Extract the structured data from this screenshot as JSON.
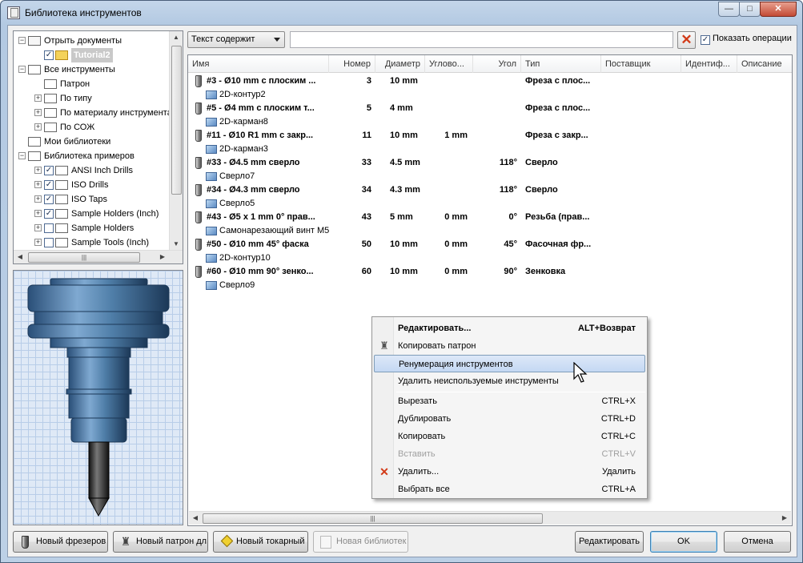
{
  "window": {
    "title": "Библиотека инструментов",
    "controls": {
      "minimize": "—",
      "maximize": "□",
      "close": "✕"
    }
  },
  "tree": {
    "items": [
      {
        "label": "Отрыть документы",
        "level": 0,
        "expander": "−",
        "checked": null,
        "icon": "open-folder-icon"
      },
      {
        "label": "Tutorial2",
        "level": 1,
        "expander": "",
        "checked": true,
        "icon": "yellow-folder-icon",
        "selected": true
      },
      {
        "label": "Все инструменты",
        "level": 0,
        "expander": "−",
        "checked": null,
        "icon": "search-folder-icon"
      },
      {
        "label": "Патрон",
        "level": 1,
        "expander": "",
        "checked": null,
        "icon": "search-folder-icon"
      },
      {
        "label": "По типу",
        "level": 1,
        "expander": "+",
        "checked": null,
        "icon": "search-folder-icon"
      },
      {
        "label": "По материалу инструмента",
        "level": 1,
        "expander": "+",
        "checked": null,
        "icon": "search-folder-icon"
      },
      {
        "label": "По СОЖ",
        "level": 1,
        "expander": "+",
        "checked": null,
        "icon": "search-folder-icon"
      },
      {
        "label": "Мои библиотеки",
        "level": 0,
        "expander": "",
        "checked": null,
        "icon": "folder-icon"
      },
      {
        "label": "Библиотека примеров",
        "level": 0,
        "expander": "−",
        "checked": null,
        "icon": "folder-icon"
      },
      {
        "label": "ANSI Inch Drills",
        "level": 1,
        "expander": "+",
        "checked": true,
        "icon": "library-icon"
      },
      {
        "label": "ISO Drills",
        "level": 1,
        "expander": "+",
        "checked": true,
        "icon": "library-icon"
      },
      {
        "label": "ISO Taps",
        "level": 1,
        "expander": "+",
        "checked": true,
        "icon": "library-icon"
      },
      {
        "label": "Sample Holders (Inch)",
        "level": 1,
        "expander": "+",
        "checked": true,
        "icon": "library-icon"
      },
      {
        "label": "Sample Holders",
        "level": 1,
        "expander": "+",
        "checked": false,
        "icon": "library-icon"
      },
      {
        "label": "Sample Tools (Inch)",
        "level": 1,
        "expander": "+",
        "checked": false,
        "icon": "library-icon"
      }
    ]
  },
  "filter": {
    "dropdown_value": "Текст содержит",
    "search_value": "",
    "show_operations_label": "Показать операции",
    "show_operations_checked": true
  },
  "list": {
    "columns": [
      "Имя",
      "Номер",
      "Диаметр",
      "Углово...",
      "Угол",
      "Тип",
      "Поставщик",
      "Идентиф...",
      "Описание"
    ],
    "rows": [
      {
        "name": "#3 - Ø10 mm с плоским ...",
        "number": "3",
        "diameter": "10 mm",
        "corner": "",
        "angle": "",
        "type": "Фреза с плос...",
        "op": "2D-контур2"
      },
      {
        "name": "#5 - Ø4 mm с плоским т...",
        "number": "5",
        "diameter": "4 mm",
        "corner": "",
        "angle": "",
        "type": "Фреза с плос...",
        "op": "2D-карман8"
      },
      {
        "name": "#11 - Ø10 R1 mm с закр...",
        "number": "11",
        "diameter": "10 mm",
        "corner": "1 mm",
        "angle": "",
        "type": "Фреза с закр...",
        "op": "2D-карман3"
      },
      {
        "name": "#33 - Ø4.5 mm сверло",
        "number": "33",
        "diameter": "4.5 mm",
        "corner": "",
        "angle": "118°",
        "type": "Сверло",
        "op": "Сверло7"
      },
      {
        "name": "#34 - Ø4.3 mm сверло",
        "number": "34",
        "diameter": "4.3 mm",
        "corner": "",
        "angle": "118°",
        "type": "Сверло",
        "op": "Сверло5"
      },
      {
        "name": "#43 - Ø5 x 1 mm 0° прав...",
        "number": "43",
        "diameter": "5 mm",
        "corner": "0 mm",
        "angle": "0°",
        "type": "Резьба (прав...",
        "op": "Самонарезающий винт M5"
      },
      {
        "name": "#50 - Ø10 mm 45° фаска",
        "number": "50",
        "diameter": "10 mm",
        "corner": "0 mm",
        "angle": "45°",
        "type": "Фасочная фр...",
        "op": "2D-контур10"
      },
      {
        "name": "#60 - Ø10 mm 90° зенко...",
        "number": "60",
        "diameter": "10 mm",
        "corner": "0 mm",
        "angle": "90°",
        "type": "Зенковка",
        "op": "Сверло9"
      }
    ]
  },
  "context_menu": {
    "items": [
      {
        "label": "Редактировать...",
        "shortcut": "ALT+Возврат",
        "bold": true,
        "disabled": false,
        "icon": ""
      },
      {
        "label": "Копировать патрон",
        "shortcut": "",
        "bold": false,
        "disabled": false,
        "icon": "holder-icon"
      },
      {
        "label": "Ренумерация инструментов",
        "shortcut": "",
        "bold": false,
        "disabled": false,
        "icon": "",
        "highlighted": true
      },
      {
        "label": "Удалить неиспользуемые инструменты",
        "shortcut": "",
        "bold": false,
        "disabled": false,
        "icon": ""
      },
      {
        "separator": true
      },
      {
        "label": "Вырезать",
        "shortcut": "CTRL+X",
        "bold": false,
        "disabled": false,
        "icon": ""
      },
      {
        "label": "Дублировать",
        "shortcut": "CTRL+D",
        "bold": false,
        "disabled": false,
        "icon": ""
      },
      {
        "label": "Копировать",
        "shortcut": "CTRL+C",
        "bold": false,
        "disabled": false,
        "icon": ""
      },
      {
        "label": "Вставить",
        "shortcut": "CTRL+V",
        "bold": false,
        "disabled": true,
        "icon": ""
      },
      {
        "label": "Удалить...",
        "shortcut": "Удалить",
        "bold": false,
        "disabled": false,
        "icon": "delete-x-icon"
      },
      {
        "label": "Выбрать все",
        "shortcut": "CTRL+A",
        "bold": false,
        "disabled": false,
        "icon": ""
      }
    ]
  },
  "buttons": {
    "new_mill": "Новый фрезеров",
    "new_holder": "Новый патрон дл",
    "new_turning": "Новый токарный",
    "new_library": "Новая библиотек",
    "edit": "Редактировать",
    "ok": "OK",
    "cancel": "Отмена"
  },
  "colors": {
    "accent_highlight": "#c4d8f3",
    "delete_red": "#d23a17",
    "preview_grid": "#dfe9f6",
    "tool_steel": "#4f7ea8"
  }
}
